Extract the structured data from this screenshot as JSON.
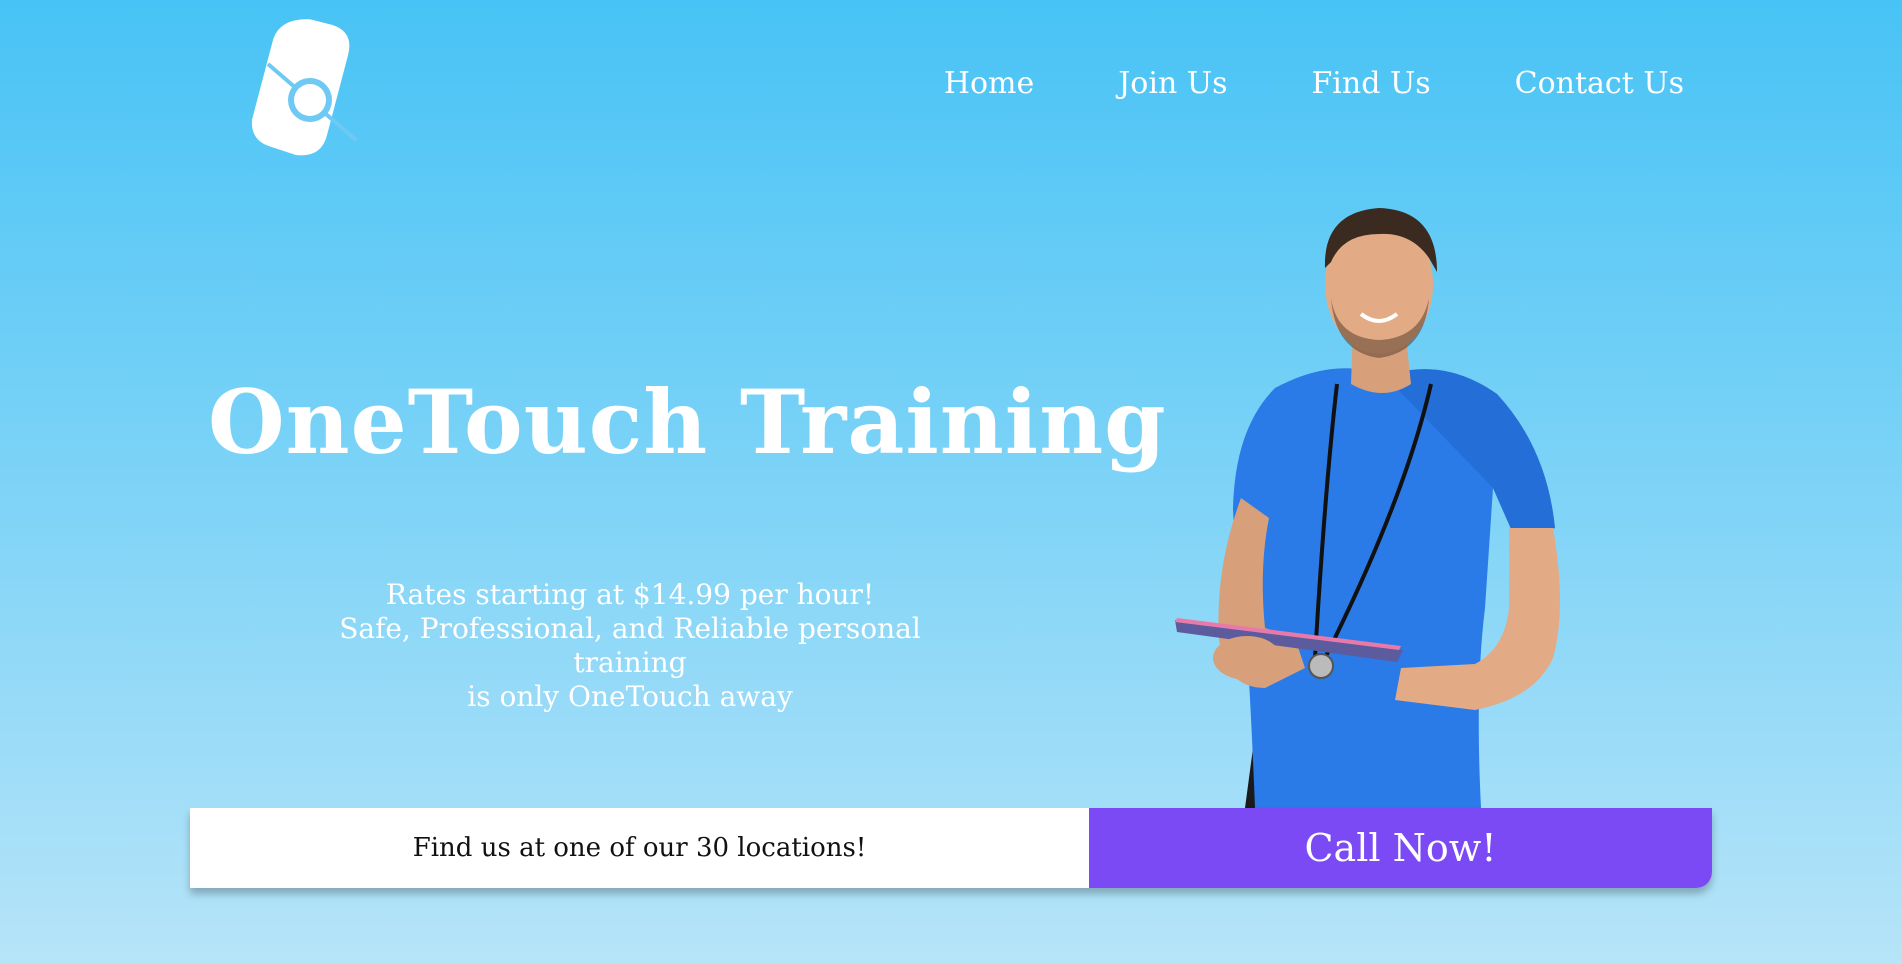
{
  "brand": {
    "logo_icon": "diamond-keyhole-logo"
  },
  "nav": {
    "items": [
      {
        "label": "Home"
      },
      {
        "label": "Join Us"
      },
      {
        "label": "Find Us"
      },
      {
        "label": "Contact Us"
      }
    ]
  },
  "hero": {
    "title": "OneTouch Training",
    "tagline_lines": [
      "Rates starting at $14.99 per hour!",
      "Safe, Professional, and Reliable personal training",
      "is only OneTouch away"
    ],
    "image_icon": "trainer-photo"
  },
  "cta": {
    "locations_label": "Find us at one of our 30 locations!",
    "call_label": "Call Now!"
  },
  "colors": {
    "background_top": "#48c3f5",
    "background_bottom": "#b6e4f8",
    "accent_purple": "#7c4af5",
    "text_white": "#ffffff",
    "shirt_blue": "#2a7ae8"
  }
}
